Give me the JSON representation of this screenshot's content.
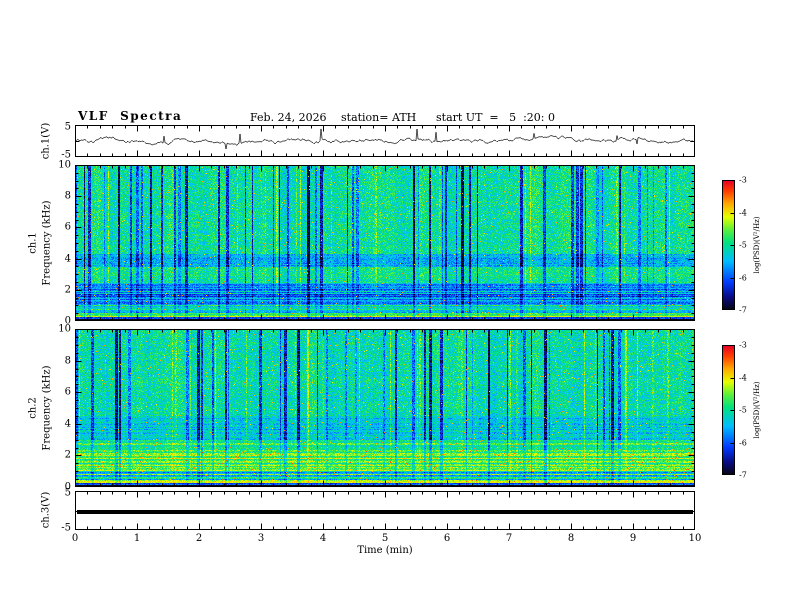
{
  "header": {
    "title": "VLF  Spectra",
    "date": "Feb. 24, 2026",
    "station": "station= ATH",
    "start_ut": "start UT  =   5  :20: 0"
  },
  "x_axis": {
    "label": "Time  (min)",
    "range": [
      0,
      10
    ],
    "major_ticks": [
      "0",
      "1",
      "2",
      "3",
      "4",
      "5",
      "6",
      "7",
      "8",
      "9",
      "10"
    ]
  },
  "chart_data": [
    {
      "type": "line",
      "name": "ch1-voltage-trace",
      "ylabel": "ch.1(V)",
      "ylim": [
        -5,
        5
      ],
      "ytick_labels": [
        "5",
        "-5"
      ],
      "summary": "noisy waveform fluctuating around 0 V with impulsive spikes to about ±4 V over 0–10 min"
    },
    {
      "type": "heatmap",
      "name": "ch1-spectrogram",
      "ylabel_lines": [
        "ch.1",
        "Frequency  (kHz)"
      ],
      "ylim_kHz": [
        0,
        10
      ],
      "ytick_labels": [
        "10",
        "8",
        "6",
        "4",
        "2",
        "0"
      ],
      "x_range_min": [
        0,
        10
      ],
      "colorbar": {
        "label": "log(PSD)(V²/Hz)",
        "range": [
          -7,
          -3
        ],
        "ticks": [
          "-3",
          "-4",
          "-5",
          "-6",
          "-7"
        ]
      },
      "summary": "green/cyan broadband background near 1e-5 above ~2.5 kHz cut by dense dark-blue vertical dropout stripes; bluer band 3.5–4.3 kHz; horizontally banded structure below 2.5 kHz with orange/red speckles; bright green sliver near 0.4 kHz; black band below ~0.2 kHz"
    },
    {
      "type": "heatmap",
      "name": "ch2-spectrogram",
      "ylabel_lines": [
        "ch.2",
        "Frequency  (kHz)"
      ],
      "ylim_kHz": [
        0,
        10
      ],
      "ytick_labels": [
        "10",
        "8",
        "6",
        "4",
        "2",
        "0"
      ],
      "x_range_min": [
        0,
        10
      ],
      "colorbar": {
        "label": "log(PSD)(V²/Hz)",
        "range": [
          -7,
          -3
        ],
        "ticks": [
          "-3",
          "-4",
          "-5",
          "-6",
          "-7"
        ]
      },
      "summary": "similar broadband background with vertical blue dropouts above ~4.5 kHz; brighter green banded region 1–3 kHz with yellow/orange horizontal lines and red speckles; bright green sliver near 0.4 kHz; black band below ~0.15 kHz"
    },
    {
      "type": "line",
      "name": "ch3-voltage-trace",
      "ylabel": "ch.3(V)",
      "ylim": [
        -5,
        5
      ],
      "ytick_labels": [
        "5",
        "-5"
      ],
      "summary": "flat thick black line just below 0 V (inactive channel)"
    }
  ]
}
